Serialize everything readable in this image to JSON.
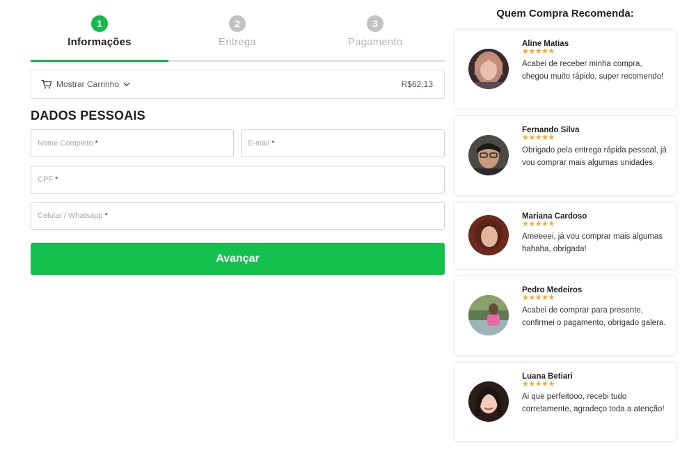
{
  "steps": [
    {
      "number": "1",
      "label": "Informações",
      "active": true
    },
    {
      "number": "2",
      "label": "Entrega",
      "active": false
    },
    {
      "number": "3",
      "label": "Pagamento",
      "active": false
    }
  ],
  "progress": 0.333,
  "cart": {
    "label": "Mostrar Carrinho",
    "price": "R$62,13"
  },
  "form": {
    "title": "DADOS PESSOAIS",
    "nome_placeholder": "Nome Completo",
    "email_placeholder": "E-mail",
    "cpf_placeholder": "CPF",
    "celular_placeholder": "Celular / Whatsapp",
    "required_mark": "*",
    "submit_label": "Avançar"
  },
  "reviews_title": "Quem Compra Recomenda:",
  "reviews": [
    {
      "name": "Aline Matias",
      "stars": "★★★★★",
      "text": "Acabei de receber minha compra, chegou muito rápido, super recomendo!"
    },
    {
      "name": "Fernando Silva",
      "stars": "★★★★★",
      "text": "Obrigado pela entrega rápida pessoal, já vou comprar mais algumas unidades."
    },
    {
      "name": "Mariana Cardoso",
      "stars": "★★★★★",
      "text": "Ameeeei, já vou comprar mais algumas hahaha, obrigada!"
    },
    {
      "name": "Pedro Medeiros",
      "stars": "★★★★★",
      "text": "Acabei de comprar para presente, confirmei o pagamento, obrigado galera."
    },
    {
      "name": "Luana Betiari",
      "stars": "★★★★★",
      "text": "Ai que perfeitooo, recebi tudo corretamente, agradeço toda a atenção!"
    }
  ],
  "colors": {
    "accent": "#13c24c",
    "star": "#f5a623",
    "inactive": "#c2c2c2"
  },
  "icons": {
    "cart": "cart-icon",
    "chevron": "chevron-down-icon"
  }
}
